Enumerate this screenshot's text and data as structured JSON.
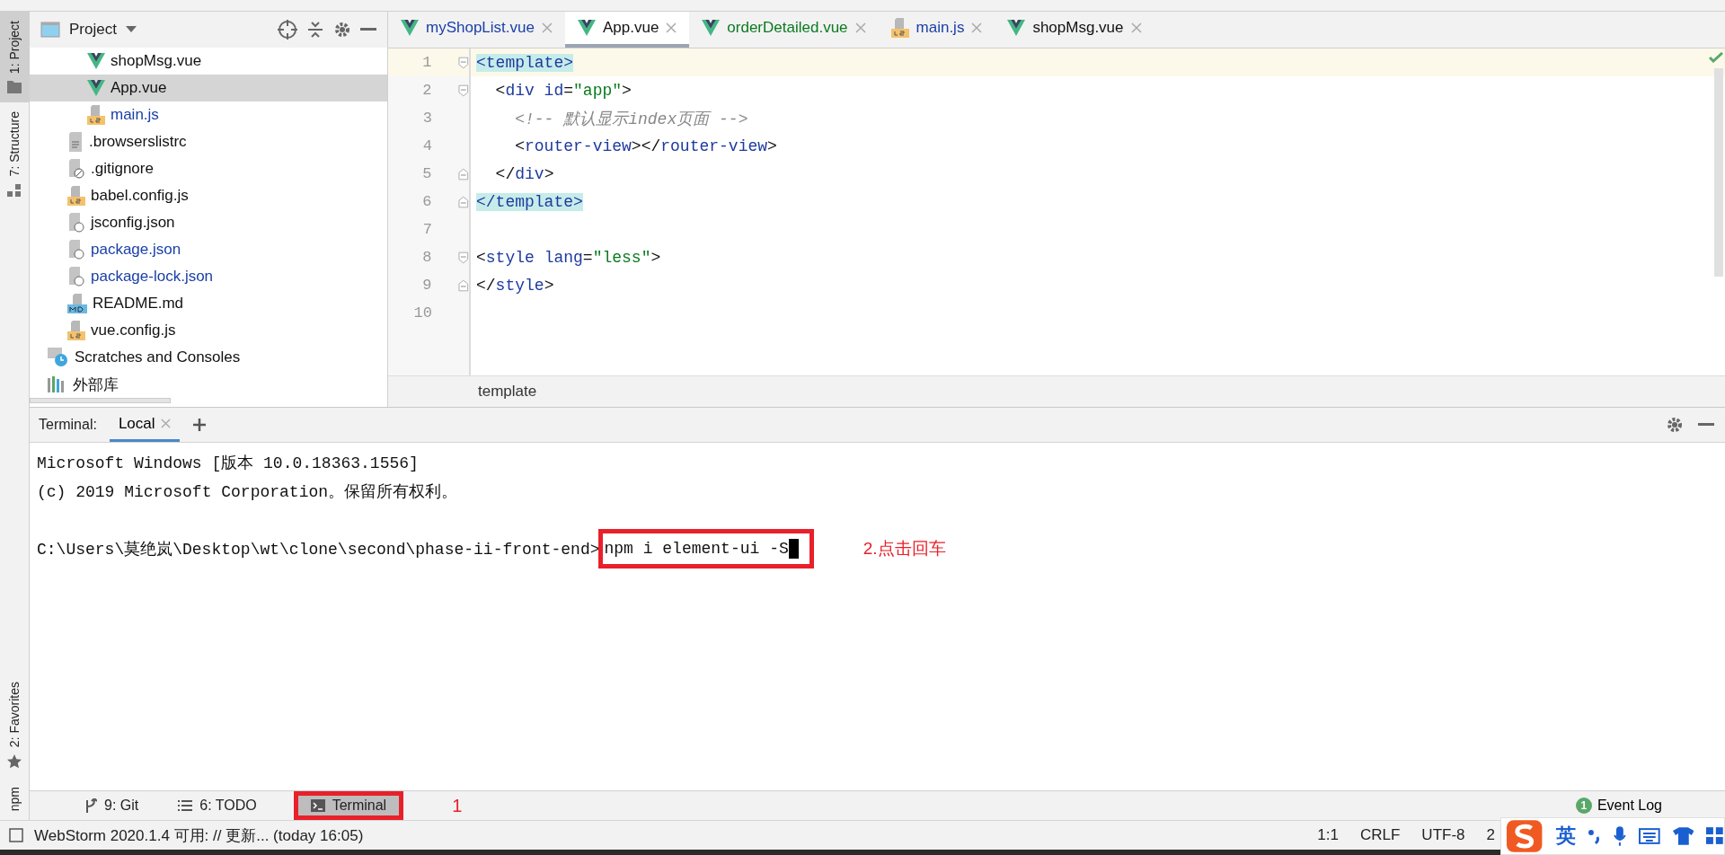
{
  "side_tools": [
    {
      "label": "1: Project",
      "selected": true,
      "kind": "folder"
    },
    {
      "label": "7: Structure",
      "selected": false,
      "kind": "structure"
    },
    {
      "label": "2: Favorites",
      "selected": false,
      "kind": "star"
    },
    {
      "label": "npm",
      "selected": false,
      "kind": "plain"
    }
  ],
  "project": {
    "title": "Project",
    "tree": [
      {
        "children": [
          {
            "children": [
              {
                "label": "shopMsg.vue",
                "kind": "vue",
                "modified": false,
                "selected": false
              },
              {
                "label": "App.vue",
                "kind": "vue",
                "modified": false,
                "selected": true
              },
              {
                "label": "main.js",
                "kind": "js",
                "modified": true,
                "selected": false
              }
            ]
          },
          {
            "label": ".browserslistrc",
            "kind": "text",
            "modified": false,
            "selected": false
          },
          {
            "label": ".gitignore",
            "kind": "ignore",
            "modified": false,
            "selected": false
          },
          {
            "label": "babel.config.js",
            "kind": "js",
            "modified": false,
            "selected": false
          },
          {
            "label": "jsconfig.json",
            "kind": "json",
            "modified": false,
            "selected": false
          },
          {
            "label": "package.json",
            "kind": "json",
            "modified": true,
            "selected": false
          },
          {
            "label": "package-lock.json",
            "kind": "json",
            "modified": true,
            "selected": false
          },
          {
            "label": "README.md",
            "kind": "md",
            "modified": false,
            "selected": false
          },
          {
            "label": "vue.config.js",
            "kind": "js",
            "modified": false,
            "selected": false
          }
        ]
      },
      {
        "label": "Scratches and Consoles",
        "kind": "scratches",
        "modified": false,
        "selected": false
      },
      {
        "label": "外部库",
        "kind": "library",
        "modified": false,
        "selected": false
      }
    ]
  },
  "editor": {
    "tabs": [
      {
        "label": "myShopList.vue",
        "kind": "vue",
        "modified": true,
        "added": false,
        "selected": false
      },
      {
        "label": "App.vue",
        "kind": "vue",
        "modified": false,
        "added": false,
        "selected": true
      },
      {
        "label": "orderDetailed.vue",
        "kind": "vue",
        "modified": false,
        "added": true,
        "selected": false
      },
      {
        "label": "main.js",
        "kind": "js",
        "modified": true,
        "added": false,
        "selected": false
      },
      {
        "label": "shopMsg.vue",
        "kind": "vue",
        "modified": false,
        "added": false,
        "selected": false
      }
    ],
    "lines": [
      {
        "number": "1",
        "current": true,
        "fold_start": true,
        "fold_end": false,
        "tokens": [
          {
            "kind": "tag",
            "text": "<template>",
            "matched": true
          }
        ]
      },
      {
        "number": "2",
        "current": false,
        "fold_start": true,
        "fold_end": false,
        "tokens": [
          {
            "kind": "plain",
            "text": "  <"
          },
          {
            "kind": "tag",
            "text": "div"
          },
          {
            "kind": "attr",
            "text": " id"
          },
          {
            "kind": "plain",
            "text": "="
          },
          {
            "kind": "string",
            "text": "\"app\""
          },
          {
            "kind": "plain",
            "text": ">"
          }
        ]
      },
      {
        "number": "3",
        "current": false,
        "fold_start": false,
        "fold_end": false,
        "tokens": [
          {
            "kind": "comment",
            "text": "    <!-- 默认显示index页面 -->"
          }
        ]
      },
      {
        "number": "4",
        "current": false,
        "fold_start": false,
        "fold_end": false,
        "tokens": [
          {
            "kind": "plain",
            "text": "    <"
          },
          {
            "kind": "tag",
            "text": "router-view"
          },
          {
            "kind": "plain",
            "text": "></"
          },
          {
            "kind": "tag",
            "text": "router-view"
          },
          {
            "kind": "plain",
            "text": ">"
          }
        ]
      },
      {
        "number": "5",
        "current": false,
        "fold_start": false,
        "fold_end": true,
        "tokens": [
          {
            "kind": "plain",
            "text": "  </"
          },
          {
            "kind": "tag",
            "text": "div"
          },
          {
            "kind": "plain",
            "text": ">"
          }
        ]
      },
      {
        "number": "6",
        "current": false,
        "fold_start": false,
        "fold_end": true,
        "tokens": [
          {
            "kind": "tag",
            "text": "</template>",
            "matched": true
          }
        ]
      },
      {
        "number": "7",
        "current": false,
        "fold_start": false,
        "fold_end": false
      },
      {
        "number": "8",
        "current": false,
        "fold_start": true,
        "fold_end": false,
        "tokens": [
          {
            "kind": "plain",
            "text": "<"
          },
          {
            "kind": "tag",
            "text": "style"
          },
          {
            "kind": "attr",
            "text": " lang"
          },
          {
            "kind": "plain",
            "text": "="
          },
          {
            "kind": "string",
            "text": "\"less\""
          },
          {
            "kind": "plain",
            "text": ">"
          }
        ]
      },
      {
        "number": "9",
        "current": false,
        "fold_start": false,
        "fold_end": true,
        "tokens": [
          {
            "kind": "plain",
            "text": "</"
          },
          {
            "kind": "tag",
            "text": "style"
          },
          {
            "kind": "plain",
            "text": ">"
          }
        ]
      },
      {
        "number": "10",
        "current": false,
        "fold_start": false,
        "fold_end": false
      }
    ],
    "breadcrumb": "template"
  },
  "terminal": {
    "title": "Terminal:",
    "tabs": [
      {
        "label": "Local",
        "selected": true
      }
    ],
    "lines": [
      "Microsoft Windows [版本 10.0.18363.1556]",
      "(c) 2019 Microsoft Corporation。保留所有权利。"
    ],
    "prompt": "C:\\Users\\莫绝岚\\Desktop\\wt\\clone\\second\\phase-ii-front-end>",
    "command": {
      "text": "npm i element-ui -S",
      "annotated": true
    },
    "note": "2.点击回车"
  },
  "tool_windows": [
    {
      "label": "9: Git",
      "kind": "git",
      "selected": false,
      "annotated": false
    },
    {
      "label": "6: TODO",
      "kind": "list",
      "selected": false,
      "annotated": false
    },
    {
      "label": "Terminal",
      "kind": "terminal",
      "selected": true,
      "annotated": true
    }
  ],
  "tool_note": "1",
  "event_log": {
    "label": "Event Log",
    "count": "1"
  },
  "status_bar": {
    "message": "WebStorm 2020.1.4 可用: // 更新... (today 16:05)",
    "items": [
      "1:1",
      "CRLF",
      "UTF-8",
      "2"
    ]
  },
  "ime": {
    "label": "英"
  }
}
